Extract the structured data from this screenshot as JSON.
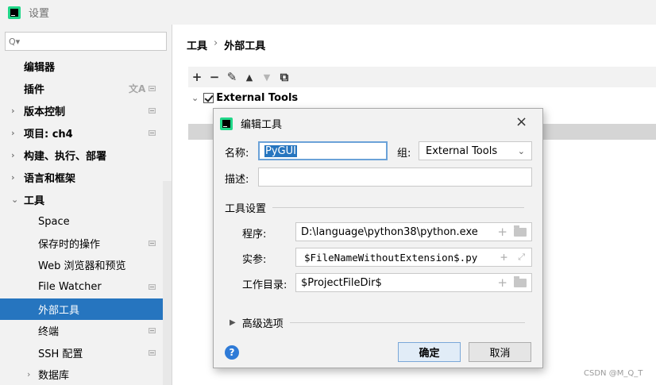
{
  "window": {
    "title": "设置"
  },
  "sidebar": {
    "search_placeholder": "Q▾",
    "items": [
      {
        "label": "编辑器"
      },
      {
        "label": "插件",
        "badge_icon": "translate-icon"
      },
      {
        "label": "版本控制"
      },
      {
        "label": "项目: ch4"
      },
      {
        "label": "构建、执行、部署"
      },
      {
        "label": "语言和框架"
      },
      {
        "label": "工具"
      },
      {
        "label": "Space"
      },
      {
        "label": "保存时的操作"
      },
      {
        "label": "Web 浏览器和预览"
      },
      {
        "label": "File Watcher"
      },
      {
        "label": "外部工具"
      },
      {
        "label": "终端"
      },
      {
        "label": "SSH 配置"
      },
      {
        "label": "数据库"
      }
    ]
  },
  "breadcrumb": {
    "parent": "工具",
    "separator": "›",
    "current": "外部工具"
  },
  "toolbar": {
    "add": "+",
    "remove": "−",
    "edit": "✎",
    "up": "▲",
    "down": "▼",
    "copy": "⧉"
  },
  "tree": {
    "group": "External Tools"
  },
  "dialog": {
    "title": "编辑工具",
    "close": "×",
    "name_label": "名称:",
    "name_value": "PyGUI",
    "group_label": "组:",
    "group_value": "External Tools",
    "desc_label": "描述:",
    "desc_value": "",
    "tool_settings": "工具设置",
    "program_label": "程序:",
    "program_value": "D:\\language\\python38\\python.exe",
    "args_label": "实参:",
    "args_value": "$FileNameWithoutExtension$.py",
    "workdir_label": "工作目录:",
    "workdir_value": "$ProjectFileDir$",
    "advanced": "高级选项",
    "help": "?",
    "ok": "确定",
    "cancel": "取消"
  },
  "watermark": "CSDN @M_Q_T",
  "colors": {
    "accent": "#2675bf",
    "help": "#2f7bd7"
  }
}
